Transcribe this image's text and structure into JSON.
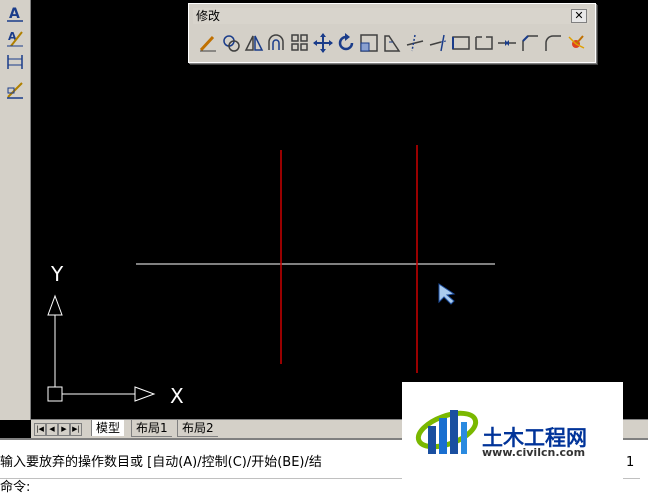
{
  "modify_toolbar": {
    "title": "修改",
    "close_label": "✕",
    "tools": [
      "erase",
      "copy",
      "mirror",
      "offset",
      "array",
      "move",
      "rotate",
      "scale",
      "stretch",
      "trim",
      "extend",
      "break-at-point",
      "break",
      "join",
      "chamfer",
      "fillet",
      "explode"
    ]
  },
  "layout_tabs": {
    "nav_buttons": [
      "|◀",
      "◀",
      "▶",
      "▶|"
    ],
    "tabs": [
      "模型",
      "布局1",
      "布局2"
    ],
    "active": "模型"
  },
  "ucs": {
    "x_label": "X",
    "y_label": "Y"
  },
  "command": {
    "history_line": "输入要放弃的操作数目或 [自动(A)/控制(C)/开始(BE)/结",
    "history_tail": "1 ",
    "prompt": "命令:",
    "input_value": ""
  },
  "watermark": {
    "name": "土木工程网",
    "url": "www.civilcn.com"
  },
  "colors": {
    "canvas": "#000000",
    "construction_line": "#ffffff",
    "red_line": "#cc0000",
    "panel": "#d4d0c8"
  }
}
